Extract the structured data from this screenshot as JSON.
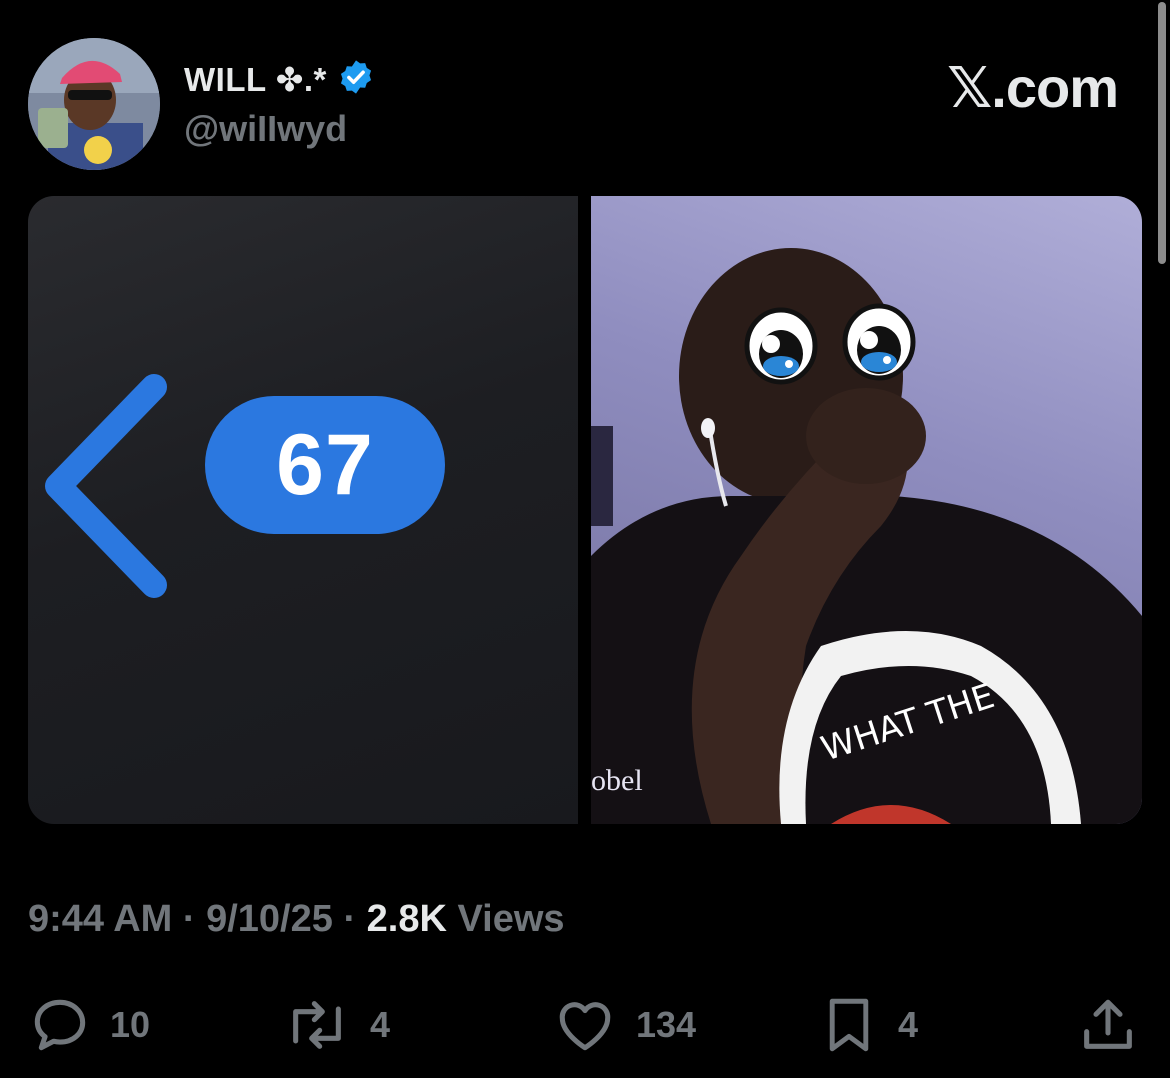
{
  "author": {
    "display_name": "WILL ✤.*",
    "handle": "@wiIIwyd",
    "verified_icon": "verified-badge-icon"
  },
  "brand": "𝕏.com",
  "media": {
    "left_image": {
      "badge_count": "67",
      "chevron_color": "#2b78e0"
    },
    "right_image": {
      "watermark": "obel",
      "shirt_text": "WHAT THE"
    }
  },
  "meta": {
    "time": "9:44 AM",
    "date": "9/10/25",
    "views_count": "2.8K",
    "views_label": "Views",
    "separator": "·"
  },
  "actions": {
    "replies": "10",
    "reposts": "4",
    "likes": "134",
    "bookmarks": "4"
  },
  "colors": {
    "background": "#000000",
    "text_primary": "#e7e9ea",
    "text_secondary": "#71767b",
    "verified_blue": "#1d9bf0",
    "badge_blue": "#2b78e0"
  }
}
